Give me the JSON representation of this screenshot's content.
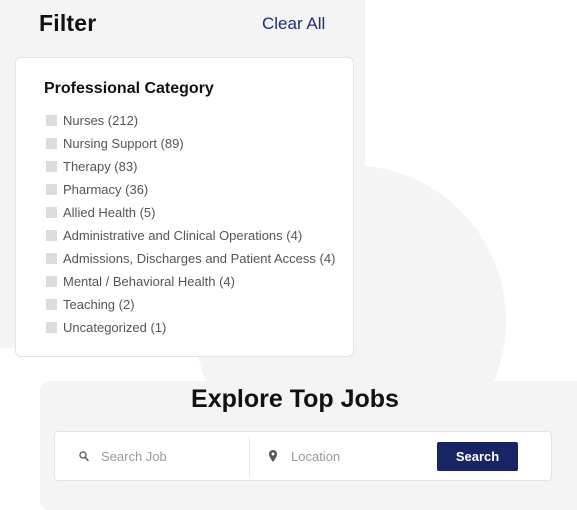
{
  "filter": {
    "title": "Filter",
    "clear_all": "Clear All",
    "category_heading": "Professional Category",
    "categories": [
      {
        "label": "Nurses (212)"
      },
      {
        "label": "Nursing Support (89)"
      },
      {
        "label": "Therapy (83)"
      },
      {
        "label": "Pharmacy (36)"
      },
      {
        "label": "Allied Health (5)"
      },
      {
        "label": "Administrative and Clinical Operations (4)"
      },
      {
        "label": "Admissions, Discharges and Patient Access (4)"
      },
      {
        "label": "Mental / Behavioral Health (4)"
      },
      {
        "label": "Teaching (2)"
      },
      {
        "label": "Uncategorized (1)"
      }
    ]
  },
  "search": {
    "title": "Explore Top Jobs",
    "job_placeholder": "Search Job",
    "location_placeholder": "Location",
    "button_label": "Search"
  },
  "icons": {
    "search": "search-icon",
    "location": "map-pin-icon"
  },
  "colors": {
    "accent": "#182565",
    "link": "#1f2d7a",
    "panel_bg": "#f4f4f5"
  }
}
